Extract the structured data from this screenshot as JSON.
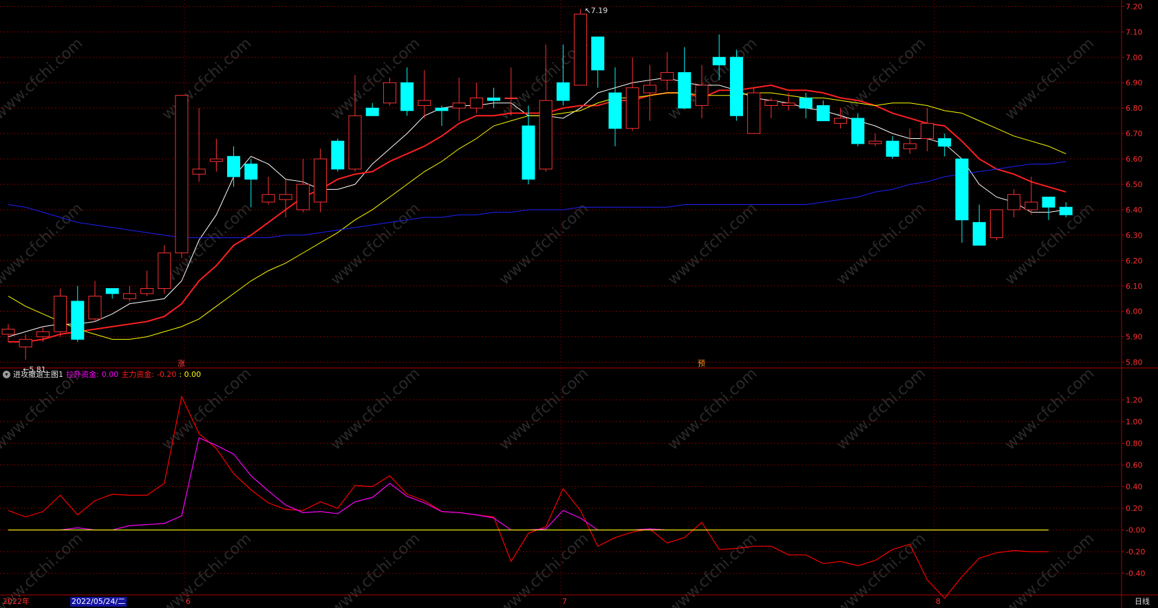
{
  "main_chart": {
    "price_labels": [
      "7.20",
      "7.10",
      "7.00",
      "6.90",
      "6.80",
      "6.70",
      "6.60",
      "6.50",
      "6.40",
      "6.30",
      "6.20",
      "6.10",
      "6.00",
      "5.90",
      "5.80"
    ],
    "high_marker": "7.19",
    "low_marker": "5.81",
    "signal_up": "涨",
    "signal_pre": "预",
    "watermark": "www.cfchi.com"
  },
  "indicator": {
    "name": "进攻撤退主图1",
    "lift_label": "拉升资金:",
    "lift_value": "0.00",
    "main_label": "主力资金:",
    "main_value": "-0.20",
    "third_value": ": 0.00",
    "axis_labels": [
      "1.20",
      "1.00",
      "0.80",
      "0.60",
      "0.40",
      "0.20",
      "-0.00",
      "-0.20",
      "-0.40"
    ]
  },
  "bottom_bar": {
    "year": "2022年",
    "cursor_date": "2022/05/24/二",
    "month_6": "6",
    "month_7": "7",
    "month_8": "8",
    "period": "日线"
  },
  "colors": {
    "up": "#ff3232",
    "down": "#00ffff",
    "ma5": "#ffffff",
    "ma10": "#ff2020",
    "ma20": "#ffff00",
    "ma60": "#2020ff",
    "lift": "#ff00ff",
    "main": "#ff0000",
    "zero": "#ffff00",
    "grid": "#7a0000",
    "axis_text": "#ff3030"
  },
  "chart_data": [
    {
      "type": "candlestick",
      "title": "",
      "ylim": [
        5.78,
        7.22
      ],
      "candles": [
        {
          "o": 5.91,
          "h": 5.95,
          "l": 5.88,
          "c": 5.93
        },
        {
          "o": 5.86,
          "h": 5.91,
          "l": 5.81,
          "c": 5.89
        },
        {
          "o": 5.9,
          "h": 5.94,
          "l": 5.88,
          "c": 5.92
        },
        {
          "o": 5.92,
          "h": 6.09,
          "l": 5.9,
          "c": 6.06
        },
        {
          "o": 6.04,
          "h": 6.1,
          "l": 5.88,
          "c": 5.89
        },
        {
          "o": 5.97,
          "h": 6.12,
          "l": 5.96,
          "c": 6.06
        },
        {
          "o": 6.09,
          "h": 6.09,
          "l": 6.05,
          "c": 6.07
        },
        {
          "o": 6.05,
          "h": 6.1,
          "l": 6.04,
          "c": 6.07
        },
        {
          "o": 6.07,
          "h": 6.16,
          "l": 6.06,
          "c": 6.09
        },
        {
          "o": 6.09,
          "h": 6.26,
          "l": 6.07,
          "c": 6.23
        },
        {
          "o": 6.23,
          "h": 6.85,
          "l": 6.21,
          "c": 6.85
        },
        {
          "o": 6.54,
          "h": 6.8,
          "l": 6.51,
          "c": 6.56
        },
        {
          "o": 6.59,
          "h": 6.68,
          "l": 6.55,
          "c": 6.6
        },
        {
          "o": 6.61,
          "h": 6.65,
          "l": 6.49,
          "c": 6.53
        },
        {
          "o": 6.58,
          "h": 6.6,
          "l": 6.41,
          "c": 6.52
        },
        {
          "o": 6.43,
          "h": 6.53,
          "l": 6.42,
          "c": 6.46
        },
        {
          "o": 6.44,
          "h": 6.52,
          "l": 6.37,
          "c": 6.46
        },
        {
          "o": 6.4,
          "h": 6.6,
          "l": 6.39,
          "c": 6.5
        },
        {
          "o": 6.43,
          "h": 6.64,
          "l": 6.39,
          "c": 6.6
        },
        {
          "o": 6.67,
          "h": 6.68,
          "l": 6.55,
          "c": 6.56
        },
        {
          "o": 6.56,
          "h": 6.93,
          "l": 6.55,
          "c": 6.77
        },
        {
          "o": 6.8,
          "h": 6.82,
          "l": 6.77,
          "c": 6.77
        },
        {
          "o": 6.82,
          "h": 6.92,
          "l": 6.81,
          "c": 6.9
        },
        {
          "o": 6.9,
          "h": 6.96,
          "l": 6.77,
          "c": 6.79
        },
        {
          "o": 6.81,
          "h": 6.95,
          "l": 6.76,
          "c": 6.83
        },
        {
          "o": 6.8,
          "h": 6.81,
          "l": 6.73,
          "c": 6.79
        },
        {
          "o": 6.8,
          "h": 6.92,
          "l": 6.75,
          "c": 6.82
        },
        {
          "o": 6.8,
          "h": 6.9,
          "l": 6.78,
          "c": 6.84
        },
        {
          "o": 6.84,
          "h": 6.88,
          "l": 6.8,
          "c": 6.83
        },
        {
          "o": 6.84,
          "h": 6.96,
          "l": 6.77,
          "c": 6.84
        },
        {
          "o": 6.73,
          "h": 6.81,
          "l": 6.5,
          "c": 6.52
        },
        {
          "o": 6.56,
          "h": 7.05,
          "l": 6.55,
          "c": 6.83
        },
        {
          "o": 6.9,
          "h": 7.05,
          "l": 6.81,
          "c": 6.83
        },
        {
          "o": 6.89,
          "h": 7.19,
          "l": 6.89,
          "c": 7.17
        },
        {
          "o": 7.08,
          "h": 7.08,
          "l": 6.88,
          "c": 6.95
        },
        {
          "o": 6.86,
          "h": 6.96,
          "l": 6.65,
          "c": 6.72
        },
        {
          "o": 6.72,
          "h": 7.0,
          "l": 6.71,
          "c": 6.88
        },
        {
          "o": 6.86,
          "h": 6.97,
          "l": 6.75,
          "c": 6.89
        },
        {
          "o": 6.91,
          "h": 7.02,
          "l": 6.87,
          "c": 6.94
        },
        {
          "o": 6.94,
          "h": 7.04,
          "l": 6.8,
          "c": 6.8
        },
        {
          "o": 6.81,
          "h": 6.97,
          "l": 6.76,
          "c": 6.89
        },
        {
          "o": 7.0,
          "h": 7.09,
          "l": 6.91,
          "c": 6.97
        },
        {
          "o": 7.0,
          "h": 7.03,
          "l": 6.75,
          "c": 6.77
        },
        {
          "o": 6.7,
          "h": 6.88,
          "l": 6.7,
          "c": 6.86
        },
        {
          "o": 6.81,
          "h": 6.84,
          "l": 6.76,
          "c": 6.83
        },
        {
          "o": 6.81,
          "h": 6.86,
          "l": 6.79,
          "c": 6.82
        },
        {
          "o": 6.84,
          "h": 6.86,
          "l": 6.76,
          "c": 6.8
        },
        {
          "o": 6.81,
          "h": 6.83,
          "l": 6.75,
          "c": 6.75
        },
        {
          "o": 6.74,
          "h": 6.8,
          "l": 6.72,
          "c": 6.76
        },
        {
          "o": 6.76,
          "h": 6.78,
          "l": 6.65,
          "c": 6.66
        },
        {
          "o": 6.66,
          "h": 6.7,
          "l": 6.65,
          "c": 6.67
        },
        {
          "o": 6.67,
          "h": 6.69,
          "l": 6.6,
          "c": 6.61
        },
        {
          "o": 6.64,
          "h": 6.72,
          "l": 6.62,
          "c": 6.66
        },
        {
          "o": 6.68,
          "h": 6.8,
          "l": 6.63,
          "c": 6.74
        },
        {
          "o": 6.68,
          "h": 6.7,
          "l": 6.61,
          "c": 6.65
        },
        {
          "o": 6.6,
          "h": 6.6,
          "l": 6.27,
          "c": 6.36
        },
        {
          "o": 6.35,
          "h": 6.42,
          "l": 6.26,
          "c": 6.26
        },
        {
          "o": 6.29,
          "h": 6.4,
          "l": 6.28,
          "c": 6.4
        },
        {
          "o": 6.4,
          "h": 6.48,
          "l": 6.37,
          "c": 6.46
        },
        {
          "o": 6.4,
          "h": 6.53,
          "l": 6.38,
          "c": 6.43
        },
        {
          "o": 6.45,
          "h": 6.45,
          "l": 6.36,
          "c": 6.41
        },
        {
          "o": 6.41,
          "h": 6.43,
          "l": 6.37,
          "c": 6.38
        }
      ],
      "ma_series": [
        {
          "key": "ma5",
          "values": [
            5.9,
            5.92,
            5.94,
            5.95,
            5.95,
            5.96,
            5.99,
            6.03,
            6.04,
            6.05,
            6.12,
            6.28,
            6.38,
            6.53,
            6.61,
            6.58,
            6.52,
            6.51,
            6.48,
            6.48,
            6.5,
            6.58,
            6.64,
            6.7,
            6.77,
            6.8,
            6.81,
            6.81,
            6.82,
            6.82,
            6.77,
            6.77,
            6.76,
            6.8,
            6.86,
            6.88,
            6.9,
            6.91,
            6.92,
            6.9,
            6.89,
            6.89,
            6.87,
            6.84,
            6.83,
            6.82,
            6.8,
            6.79,
            6.77,
            6.75,
            6.73,
            6.7,
            6.68,
            6.68,
            6.66,
            6.6,
            6.5,
            6.45,
            6.43,
            6.39,
            6.39,
            6.4
          ]
        },
        {
          "key": "ma10",
          "values": [
            5.88,
            5.88,
            5.89,
            5.91,
            5.92,
            5.93,
            5.94,
            5.95,
            5.96,
            5.98,
            6.03,
            6.12,
            6.18,
            6.26,
            6.3,
            6.35,
            6.4,
            6.45,
            6.48,
            6.52,
            6.54,
            6.55,
            6.59,
            6.62,
            6.65,
            6.69,
            6.74,
            6.77,
            6.77,
            6.78,
            6.78,
            6.78,
            6.8,
            6.81,
            6.81,
            6.83,
            6.83,
            6.85,
            6.86,
            6.86,
            6.84,
            6.87,
            6.87,
            6.88,
            6.89,
            6.87,
            6.87,
            6.86,
            6.84,
            6.83,
            6.81,
            6.78,
            6.76,
            6.74,
            6.73,
            6.67,
            6.6,
            6.56,
            6.54,
            6.51,
            6.49,
            6.47
          ]
        },
        {
          "key": "ma20",
          "values": [
            6.06,
            6.02,
            5.99,
            5.96,
            5.93,
            5.91,
            5.89,
            5.89,
            5.9,
            5.92,
            5.94,
            5.97,
            6.02,
            6.07,
            6.12,
            6.16,
            6.19,
            6.23,
            6.27,
            6.31,
            6.36,
            6.4,
            6.45,
            6.5,
            6.55,
            6.59,
            6.64,
            6.68,
            6.73,
            6.75,
            6.77,
            6.77,
            6.78,
            6.79,
            6.82,
            6.84,
            6.84,
            6.85,
            6.86,
            6.86,
            6.85,
            6.85,
            6.85,
            6.86,
            6.86,
            6.85,
            6.84,
            6.84,
            6.83,
            6.82,
            6.81,
            6.82,
            6.82,
            6.81,
            6.79,
            6.78,
            6.75,
            6.72,
            6.69,
            6.67,
            6.65,
            6.62
          ]
        },
        {
          "key": "ma60",
          "values": [
            6.42,
            6.41,
            6.39,
            6.37,
            6.35,
            6.34,
            6.33,
            6.32,
            6.31,
            6.3,
            6.29,
            6.29,
            6.29,
            6.29,
            6.29,
            6.29,
            6.3,
            6.3,
            6.31,
            6.32,
            6.33,
            6.34,
            6.35,
            6.36,
            6.37,
            6.37,
            6.38,
            6.38,
            6.39,
            6.39,
            6.4,
            6.4,
            6.4,
            6.41,
            6.41,
            6.41,
            6.41,
            6.41,
            6.41,
            6.42,
            6.42,
            6.42,
            6.42,
            6.42,
            6.42,
            6.42,
            6.42,
            6.43,
            6.44,
            6.45,
            6.47,
            6.48,
            6.5,
            6.51,
            6.53,
            6.54,
            6.55,
            6.56,
            6.57,
            6.58,
            6.58,
            6.59
          ]
        }
      ]
    },
    {
      "type": "line",
      "title": "进攻撤退主图1",
      "ylim": [
        -0.58,
        1.38
      ],
      "series": [
        {
          "name": "主力资金",
          "values": [
            0.18,
            0.12,
            0.17,
            0.32,
            0.14,
            0.27,
            0.33,
            0.32,
            0.32,
            0.43,
            1.23,
            0.89,
            0.75,
            0.52,
            0.37,
            0.25,
            0.19,
            0.18,
            0.26,
            0.2,
            0.41,
            0.4,
            0.5,
            0.33,
            0.27,
            0.17,
            0.16,
            0.14,
            0.12,
            -0.29,
            -0.03,
            0.03,
            0.38,
            0.18,
            -0.15,
            -0.07,
            -0.02,
            0.01,
            -0.12,
            -0.07,
            0.07,
            -0.18,
            -0.17,
            -0.15,
            -0.15,
            -0.23,
            -0.23,
            -0.31,
            -0.29,
            -0.33,
            -0.28,
            -0.18,
            -0.13,
            -0.46,
            -0.63,
            -0.43,
            -0.26,
            -0.21,
            -0.19,
            -0.2,
            -0.2
          ]
        },
        {
          "name": "拉升资金",
          "values": [
            0.0,
            0.0,
            0.0,
            0.0,
            0.02,
            0.0,
            0.0,
            0.04,
            0.05,
            0.06,
            0.13,
            0.85,
            0.78,
            0.7,
            0.5,
            0.36,
            0.23,
            0.16,
            0.17,
            0.15,
            0.26,
            0.3,
            0.43,
            0.31,
            0.25,
            0.17,
            0.16,
            0.14,
            0.11,
            0.0,
            0.0,
            0.01,
            0.18,
            0.11,
            0.0,
            0.0,
            0.0,
            0.01,
            0.0,
            0.0,
            0.0,
            0.0,
            0.0,
            0.0,
            0.0,
            0.0,
            0.0,
            0.0,
            0.0,
            0.0,
            0.0,
            0.0,
            0.0,
            0.0,
            0.0,
            0.0,
            0.0,
            0.0,
            0.0,
            0.0,
            0.0
          ]
        },
        {
          "values": [
            0.0,
            0.0,
            0.0,
            0.0,
            0.0,
            0.0,
            0.0,
            0.0,
            0.0,
            0.0,
            0.0,
            0.0,
            0.0,
            0.0,
            0.0,
            0.0,
            0.0,
            0.0,
            0.0,
            0.0,
            0.0,
            0.0,
            0.0,
            0.0,
            0.0,
            0.0,
            0.0,
            0.0,
            0.0,
            0.0,
            0.0,
            0.0,
            0.0,
            0.0,
            0.0,
            0.0,
            0.0,
            0.0,
            0.0,
            0.0,
            0.0,
            0.0,
            0.0,
            0.0,
            0.0,
            0.0,
            0.0,
            0.0,
            0.0,
            0.0,
            0.0,
            0.0,
            0.0,
            0.0,
            0.0,
            0.0,
            0.0,
            0.0,
            0.0,
            0.0,
            0.0
          ]
        }
      ]
    }
  ]
}
